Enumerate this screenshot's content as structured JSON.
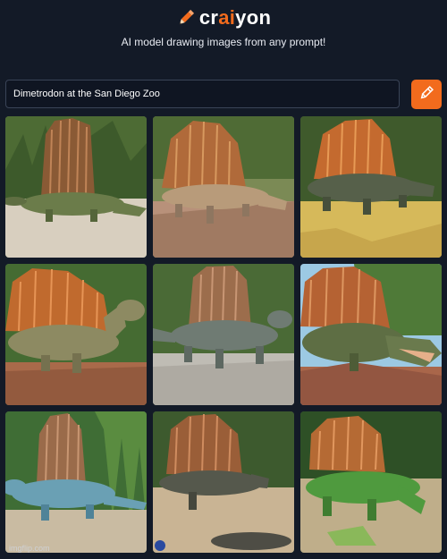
{
  "header": {
    "logo_pre": "cr",
    "logo_accent": "ai",
    "logo_post": "yon",
    "tagline": "AI model drawing images from any prompt!"
  },
  "prompt": {
    "value": "Dimetrodon at the San Diego Zoo"
  },
  "watermark": "imgflip.com",
  "colors": {
    "background": "#131a27",
    "accent": "#f26b1d"
  },
  "icons": {
    "logo": "pencil-icon",
    "draw_button": "pencil-icon"
  }
}
